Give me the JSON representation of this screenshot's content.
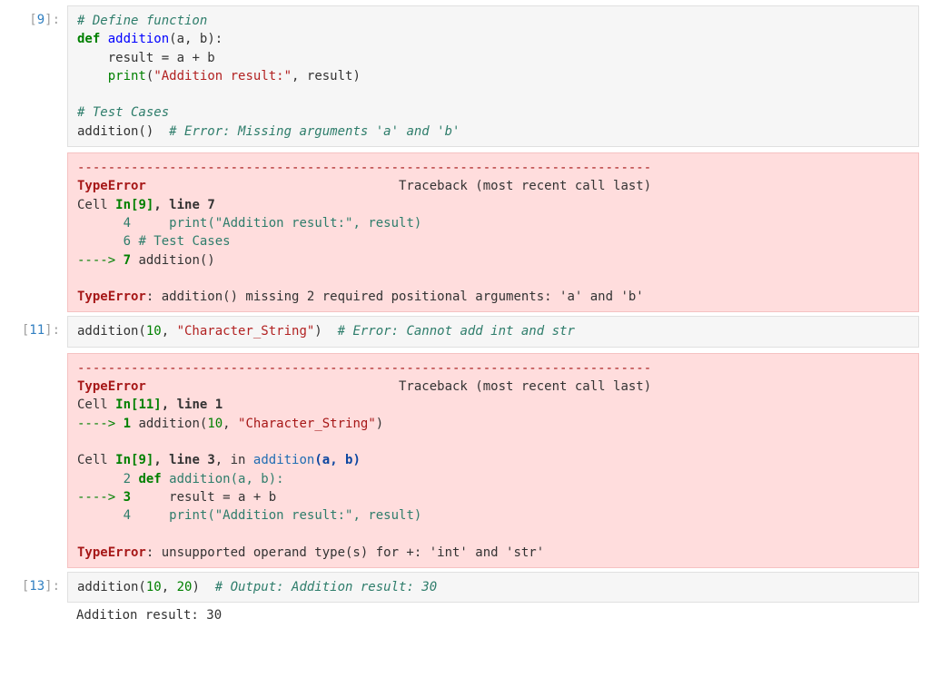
{
  "cells": [
    {
      "prompt_open": "[",
      "prompt_num": "9",
      "prompt_close": "]:",
      "code": {
        "l1_comment": "# Define function",
        "l2_def": "def",
        "l2_name": "addition",
        "l2_sig": "(a, b):",
        "l3_indent": "    result ",
        "l3_eq": "=",
        "l3_rest": " a + b",
        "l4_indent": "    ",
        "l4_print": "print",
        "l4_popen": "(",
        "l4_str": "\"Addition result:\"",
        "l4_rest": ", result)",
        "l6_comment": "# Test Cases",
        "l7_call": "addition()  ",
        "l7_comment": "# Error: Missing arguments 'a' and 'b'"
      },
      "traceback": {
        "hr": "---------------------------------------------------------------------------",
        "exc": "TypeError",
        "tb_label": "                                 Traceback (most recent call last)",
        "cell_lbl": "Cell ",
        "in9": "In[9]",
        "line7": ", line 7",
        "row4_num": "      4",
        "row4_print": "     print",
        "row4_paren": "(",
        "row4_str": "\"Addition result:\"",
        "row4_rest": ", result)",
        "row6_num": "      6",
        "row6_txt": " # Test Cases",
        "arrow7": "----> ",
        "seven": "7",
        "row7_txt": " addition()",
        "msg_pfx": "TypeError",
        "msg_rest": ": addition() missing 2 required positional arguments: 'a' and 'b'"
      }
    },
    {
      "prompt_open": "[",
      "prompt_num": "11",
      "prompt_close": "]:",
      "code": {
        "call_head": "addition(",
        "arg1": "10",
        "comma": ", ",
        "arg2": "\"Character_String\"",
        "close": ")  ",
        "comment": "# Error: Cannot add int and str"
      },
      "traceback": {
        "hr": "---------------------------------------------------------------------------",
        "exc": "TypeError",
        "tb_label": "                                 Traceback (most recent call last)",
        "cell_lbl": "Cell ",
        "in11": "In[11]",
        "line1": ", line 1",
        "arrow1": "----> ",
        "one": "1",
        "row1_head": " addition(",
        "row1_num": "10",
        "row1_sep": ", ",
        "row1_str": "\"Character_String\"",
        "row1_close": ")",
        "cell2_lbl": "Cell ",
        "in9": "In[9]",
        "line3": ", line 3",
        "in_txt": ", in ",
        "func": "addition",
        "sigopen": "(a, b)",
        "row2_num": "      2",
        "row2_def": " def",
        "row2_rest": " addition(a, b):",
        "arrow3": "----> ",
        "three": "3",
        "row3_txt": "     result = a + b",
        "row4_num": "      4",
        "row4_print": "     print",
        "row4_paren": "(",
        "row4_str": "\"Addition result:\"",
        "row4_rest": ", result)",
        "msg_pfx": "TypeError",
        "msg_rest": ": unsupported operand type(s) for +: 'int' and 'str'"
      }
    },
    {
      "prompt_open": "[",
      "prompt_num": "13",
      "prompt_close": "]:",
      "code": {
        "call_head": "addition(",
        "arg1": "10",
        "comma": ", ",
        "arg2": "20",
        "close": ")  ",
        "comment": "# Output: Addition result: 30"
      },
      "output": "Addition result: 30"
    }
  ]
}
